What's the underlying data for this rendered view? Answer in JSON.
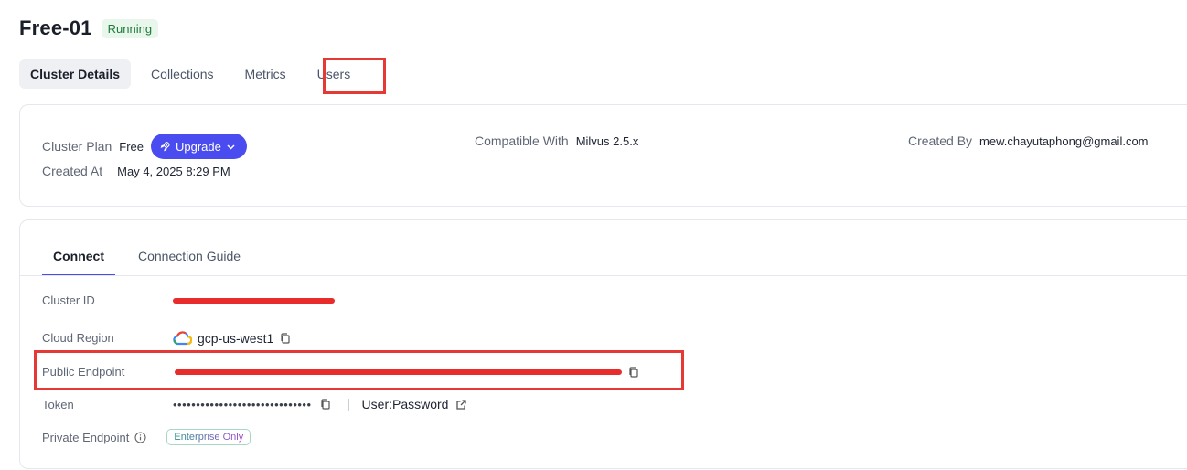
{
  "header": {
    "title": "Free-01",
    "status": "Running"
  },
  "tabs": [
    {
      "label": "Cluster Details"
    },
    {
      "label": "Collections"
    },
    {
      "label": "Metrics"
    },
    {
      "label": "Users"
    }
  ],
  "plan_card": {
    "cluster_plan_label": "Cluster Plan",
    "cluster_plan_value": "Free",
    "upgrade_label": "Upgrade",
    "created_at_label": "Created At",
    "created_at_value": "May 4, 2025 8:29 PM",
    "compatible_label": "Compatible With",
    "compatible_value": "Milvus 2.5.x",
    "created_by_label": "Created By",
    "created_by_value": "mew.chayutaphong@gmail.com"
  },
  "connect_card": {
    "tabs": [
      {
        "label": "Connect"
      },
      {
        "label": "Connection Guide"
      }
    ],
    "cluster_id_label": "Cluster ID",
    "cloud_region_label": "Cloud Region",
    "cloud_region_value": "gcp-us-west1",
    "public_endpoint_label": "Public Endpoint",
    "token_label": "Token",
    "token_value": "••••••••••••••••••••••••••••••",
    "user_password_label": "User:Password",
    "private_endpoint_label": "Private Endpoint",
    "enterprise_badge": "Enterprise Only"
  },
  "colors": {
    "accent": "#4a4cf0",
    "status_green": "#1f7a3c",
    "highlight_red": "#e53935"
  },
  "icons": [
    "rocket-icon",
    "chevron-down-icon",
    "copy-icon",
    "gcp-cloud-icon",
    "external-link-icon",
    "info-icon"
  ]
}
